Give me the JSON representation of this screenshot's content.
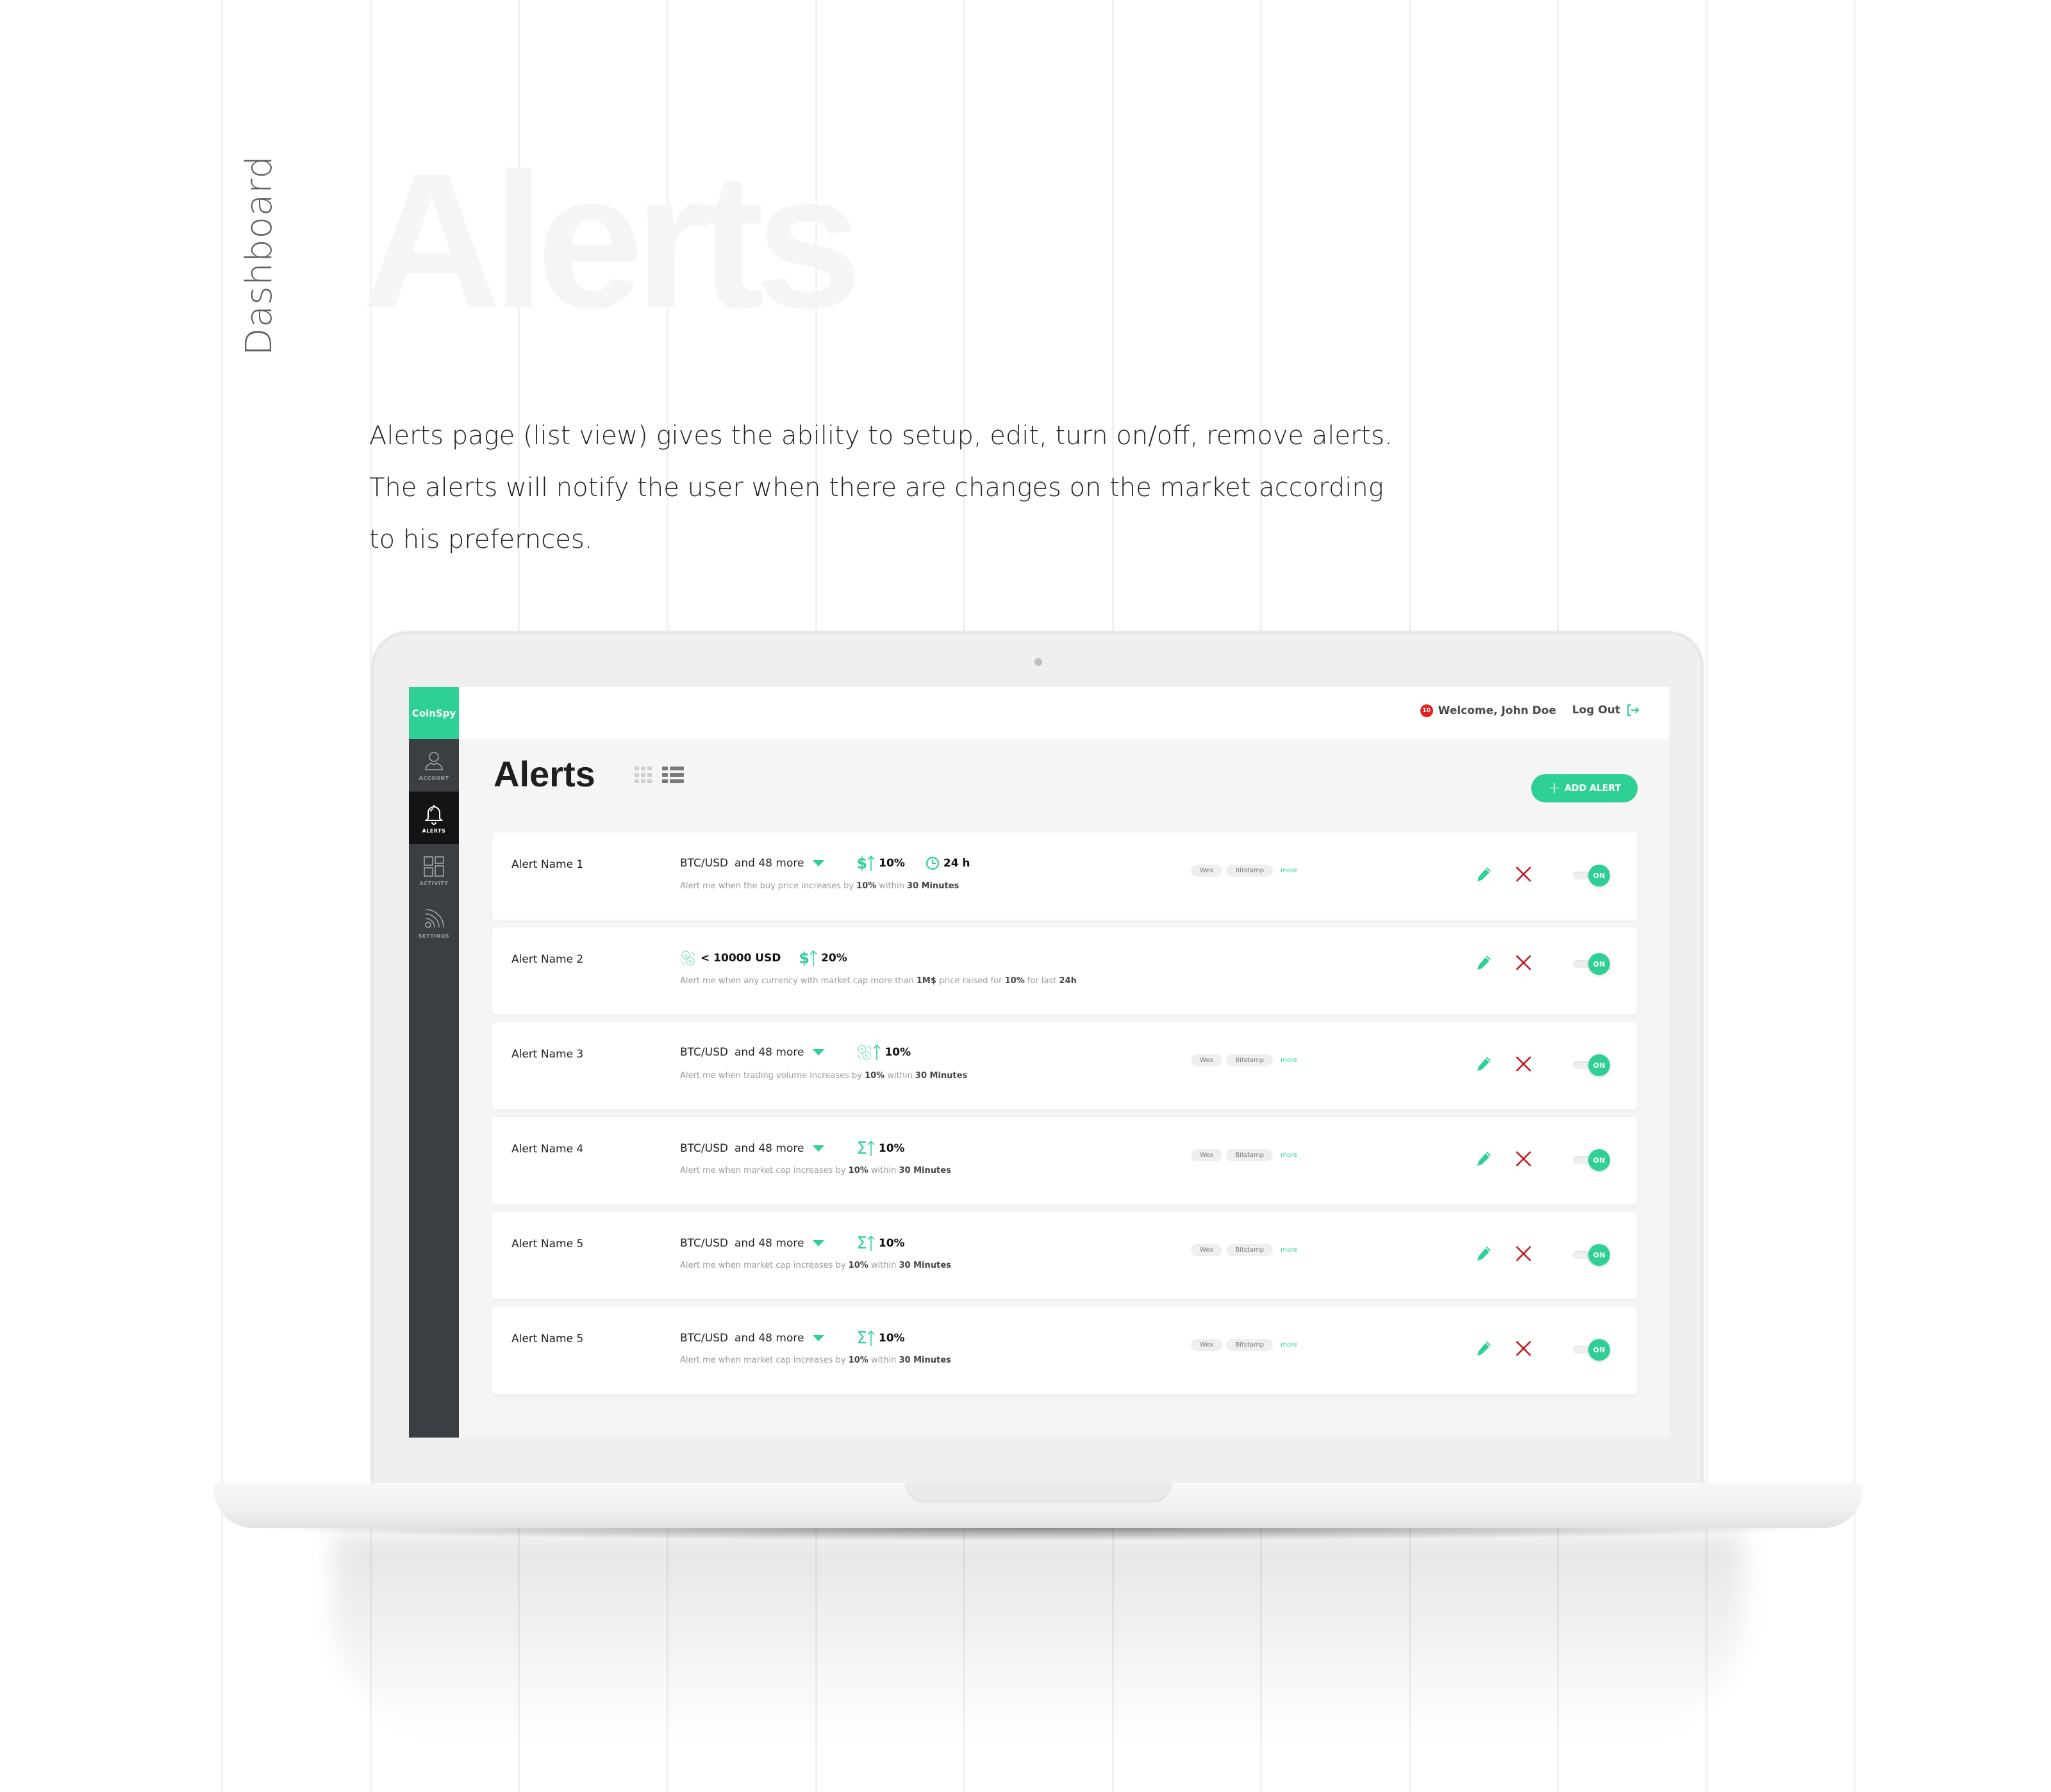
{
  "page": {
    "side_title": "Dashboard",
    "ghost_title": "Alerts",
    "description": "Alerts page (list view) gives the ability to setup, edit, turn on/off, remove alerts. The alerts will notify the user when there are changes on the market according to his prefernces."
  },
  "colors": {
    "brand": "#2fd095",
    "sidebar": "#3b3e42",
    "sidebar_active": "#131416",
    "danger": "#c0161c",
    "badge": "#e52222"
  },
  "app": {
    "logo": "CoinSpy",
    "nav": [
      {
        "label": "ACCOUNT",
        "icon": "user-icon",
        "active": false
      },
      {
        "label": "ALERTS",
        "icon": "bell-icon",
        "active": true
      },
      {
        "label": "ACTIVITY",
        "icon": "grid-icon",
        "active": false
      },
      {
        "label": "SETTINGS",
        "icon": "rss-icon",
        "active": false
      }
    ],
    "header": {
      "notification_count": "10",
      "welcome": "Welcome, John Doe",
      "logout": "Log Out"
    },
    "title": "Alerts",
    "view_modes": [
      "grid",
      "list"
    ],
    "active_view": "list",
    "add_button": "ADD ALERT",
    "alerts": [
      {
        "name": "Alert Name 1",
        "pair": "BTC/USD",
        "more": "and 48 more",
        "metrics": [
          {
            "icon": "dollar-up-icon",
            "value": "10%"
          },
          {
            "icon": "clock-icon",
            "value": "24 h"
          }
        ],
        "description": {
          "pre": "Alert me when the buy price increases by ",
          "b1": "10%",
          "mid": " within ",
          "b2": "30 Minutes",
          "post": ""
        },
        "tags": [
          "Wex",
          "Bitstamp"
        ],
        "more_link": "more",
        "toggle": "ON"
      },
      {
        "name": "Alert Name 2",
        "pair": "",
        "more": "",
        "cap_filter": "< 10000 USD",
        "metrics": [
          {
            "icon": "dollar-up-icon",
            "value": "20%"
          }
        ],
        "description": {
          "pre": "Alert me when any currency with market cap more than ",
          "b1": "1M$",
          "mid": " price raised for ",
          "b2": "10%",
          "mid2": " for last ",
          "b3": "24h"
        },
        "tags": [],
        "more_link": "",
        "toggle": "ON"
      },
      {
        "name": "Alert Name 3",
        "pair": "BTC/USD",
        "more": "and 48 more",
        "metrics": [
          {
            "icon": "volume-up-icon",
            "value": "10%"
          }
        ],
        "description": {
          "pre": "Alert me when trading volume increases by ",
          "b1": "10%",
          "mid": " within ",
          "b2": "30 Minutes",
          "post": ""
        },
        "tags": [
          "Wex",
          "Bitstamp"
        ],
        "more_link": "more",
        "toggle": "ON"
      },
      {
        "name": "Alert Name 4",
        "pair": "BTC/USD",
        "more": "and 48 more",
        "metrics": [
          {
            "icon": "sigma-up-icon",
            "value": "10%"
          }
        ],
        "description": {
          "pre": "Alert me when market cap increases by ",
          "b1": "10%",
          "mid": " within ",
          "b2": "30 Minutes",
          "post": ""
        },
        "tags": [
          "Wex",
          "Bitstamp"
        ],
        "more_link": "more",
        "toggle": "ON"
      },
      {
        "name": "Alert Name 5",
        "pair": "BTC/USD",
        "more": "and 48 more",
        "metrics": [
          {
            "icon": "sigma-up-icon",
            "value": "10%"
          }
        ],
        "description": {
          "pre": "Alert me when market cap increases by ",
          "b1": "10%",
          "mid": " within ",
          "b2": "30 Minutes",
          "post": ""
        },
        "tags": [
          "Wex",
          "Bitstamp"
        ],
        "more_link": "more",
        "toggle": "ON"
      },
      {
        "name": "Alert Name 5",
        "pair": "BTC/USD",
        "more": "and 48 more",
        "metrics": [
          {
            "icon": "sigma-up-icon",
            "value": "10%"
          }
        ],
        "description": {
          "pre": "Alert me when market cap increases by ",
          "b1": "10%",
          "mid": " within ",
          "b2": "30 Minutes",
          "post": ""
        },
        "tags": [
          "Wex",
          "Bitstamp"
        ],
        "more_link": "more",
        "toggle": "ON"
      }
    ]
  }
}
